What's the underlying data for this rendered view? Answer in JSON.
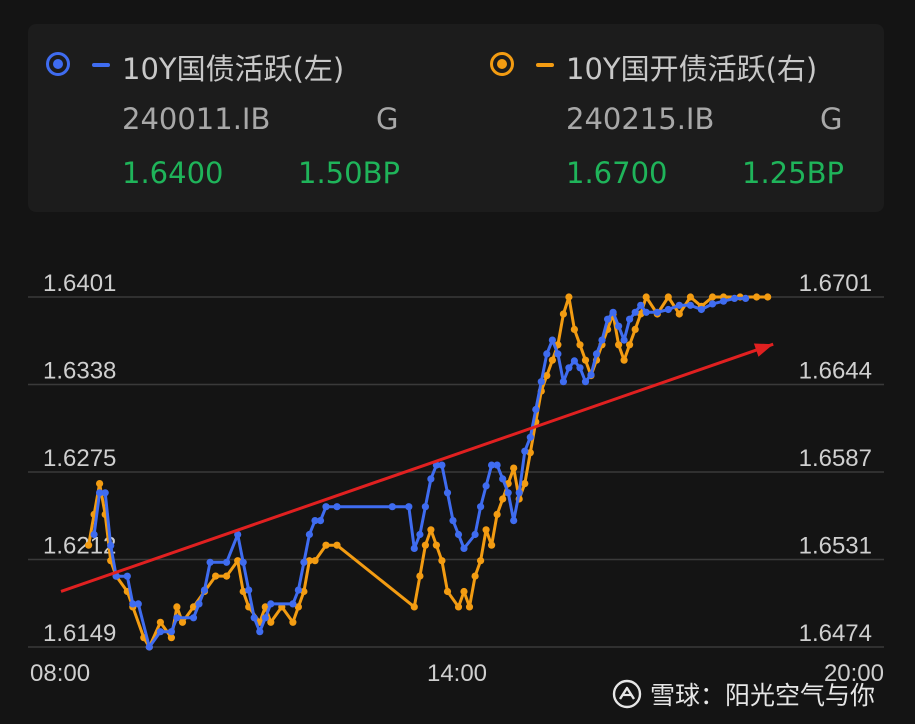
{
  "legend": {
    "left": {
      "name": "10Y国债活跃(左)",
      "code": "240011.IB",
      "flag": "G",
      "price": "1.6400",
      "change": "1.50BP",
      "color": "#3f6cf0"
    },
    "right": {
      "name": "10Y国开债活跃(右)",
      "code": "240215.IB",
      "flag": "G",
      "price": "1.6700",
      "change": "1.25BP",
      "color": "#f39c12"
    }
  },
  "watermark": {
    "text": "雪球：阳光空气与你",
    "icon": "snowball-logo-icon"
  },
  "colors": {
    "background": "#141414",
    "panel": "#1c1c1c",
    "up_green": "#1fb45a",
    "arrow_red": "#e02020",
    "grid": "#3a3a3a"
  },
  "chart_data": {
    "type": "line",
    "x_ticks": [
      "08:00",
      "14:00",
      "20:00"
    ],
    "x_range": [
      "08:00",
      "20:00"
    ],
    "left_axis": {
      "ticks": [
        "1.6401",
        "1.6338",
        "1.6275",
        "1.6212",
        "1.6149"
      ],
      "range": [
        1.6149,
        1.6401
      ]
    },
    "right_axis": {
      "ticks": [
        "1.6701",
        "1.6644",
        "1.6587",
        "1.6531",
        "1.6474"
      ],
      "range": [
        1.6474,
        1.6701
      ]
    },
    "grid": true,
    "annotation": {
      "type": "arrow",
      "from": {
        "t": "08:00",
        "left_value": 1.6189
      },
      "to": {
        "t": "18:45",
        "left_value": 1.6367
      }
    },
    "series": [
      {
        "name": "10Y国债活跃(左)",
        "axis": "left",
        "color": "#3f6cf0",
        "points": [
          [
            "08:30",
            1.623
          ],
          [
            "08:35",
            1.626
          ],
          [
            "08:40",
            1.626
          ],
          [
            "08:45",
            1.6222
          ],
          [
            "08:50",
            1.62
          ],
          [
            "09:00",
            1.62
          ],
          [
            "09:05",
            1.618
          ],
          [
            "09:10",
            1.618
          ],
          [
            "09:20",
            1.6149
          ],
          [
            "09:30",
            1.616
          ],
          [
            "09:40",
            1.616
          ],
          [
            "09:45",
            1.617
          ],
          [
            "10:00",
            1.617
          ],
          [
            "10:05",
            1.618
          ],
          [
            "10:10",
            1.619
          ],
          [
            "10:15",
            1.621
          ],
          [
            "10:30",
            1.621
          ],
          [
            "10:40",
            1.623
          ],
          [
            "10:45",
            1.621
          ],
          [
            "10:50",
            1.619
          ],
          [
            "10:55",
            1.617
          ],
          [
            "11:00",
            1.616
          ],
          [
            "11:05",
            1.617
          ],
          [
            "11:10",
            1.618
          ],
          [
            "11:30",
            1.618
          ],
          [
            "11:35",
            1.619
          ],
          [
            "11:40",
            1.621
          ],
          [
            "11:45",
            1.623
          ],
          [
            "11:50",
            1.624
          ],
          [
            "11:55",
            1.624
          ],
          [
            "12:00",
            1.625
          ],
          [
            "12:10",
            1.625
          ],
          [
            "13:00",
            1.625
          ],
          [
            "13:15",
            1.625
          ],
          [
            "13:20",
            1.622
          ],
          [
            "13:25",
            1.623
          ],
          [
            "13:30",
            1.625
          ],
          [
            "13:35",
            1.627
          ],
          [
            "13:40",
            1.628
          ],
          [
            "13:45",
            1.628
          ],
          [
            "13:50",
            1.626
          ],
          [
            "13:55",
            1.624
          ],
          [
            "14:00",
            1.623
          ],
          [
            "14:05",
            1.622
          ],
          [
            "14:15",
            1.623
          ],
          [
            "14:20",
            1.625
          ],
          [
            "14:25",
            1.6265
          ],
          [
            "14:30",
            1.628
          ],
          [
            "14:35",
            1.628
          ],
          [
            "14:40",
            1.627
          ],
          [
            "14:45",
            1.626
          ],
          [
            "14:50",
            1.624
          ],
          [
            "14:55",
            1.626
          ],
          [
            "15:00",
            1.629
          ],
          [
            "15:05",
            1.63
          ],
          [
            "15:10",
            1.632
          ],
          [
            "15:15",
            1.634
          ],
          [
            "15:20",
            1.636
          ],
          [
            "15:25",
            1.637
          ],
          [
            "15:30",
            1.636
          ],
          [
            "15:35",
            1.634
          ],
          [
            "15:40",
            1.635
          ],
          [
            "15:45",
            1.6355
          ],
          [
            "15:50",
            1.635
          ],
          [
            "15:55",
            1.634
          ],
          [
            "16:00",
            1.6345
          ],
          [
            "16:05",
            1.636
          ],
          [
            "16:10",
            1.637
          ],
          [
            "16:15",
            1.6385
          ],
          [
            "16:20",
            1.639
          ],
          [
            "16:25",
            1.638
          ],
          [
            "16:30",
            1.637
          ],
          [
            "16:35",
            1.6385
          ],
          [
            "16:40",
            1.639
          ],
          [
            "16:45",
            1.6395
          ],
          [
            "16:50",
            1.639
          ],
          [
            "17:00",
            1.639
          ],
          [
            "17:10",
            1.6392
          ],
          [
            "17:20",
            1.6395
          ],
          [
            "17:30",
            1.6395
          ],
          [
            "17:40",
            1.6392
          ],
          [
            "17:50",
            1.6396
          ],
          [
            "18:00",
            1.6398
          ],
          [
            "18:10",
            1.64
          ],
          [
            "18:20",
            1.64
          ]
        ]
      },
      {
        "name": "10Y国开债活跃(右)",
        "axis": "right",
        "color": "#f39c12",
        "points": [
          [
            "08:25",
            1.654
          ],
          [
            "08:30",
            1.656
          ],
          [
            "08:35",
            1.658
          ],
          [
            "08:40",
            1.656
          ],
          [
            "08:45",
            1.653
          ],
          [
            "08:50",
            1.652
          ],
          [
            "09:00",
            1.651
          ],
          [
            "09:05",
            1.65
          ],
          [
            "09:15",
            1.648
          ],
          [
            "09:20",
            1.6474
          ],
          [
            "09:30",
            1.649
          ],
          [
            "09:40",
            1.648
          ],
          [
            "09:45",
            1.65
          ],
          [
            "09:50",
            1.649
          ],
          [
            "10:00",
            1.65
          ],
          [
            "10:10",
            1.651
          ],
          [
            "10:20",
            1.652
          ],
          [
            "10:30",
            1.652
          ],
          [
            "10:40",
            1.653
          ],
          [
            "10:45",
            1.651
          ],
          [
            "10:50",
            1.65
          ],
          [
            "11:00",
            1.649
          ],
          [
            "11:05",
            1.65
          ],
          [
            "11:10",
            1.649
          ],
          [
            "11:20",
            1.65
          ],
          [
            "11:30",
            1.649
          ],
          [
            "11:35",
            1.65
          ],
          [
            "11:40",
            1.651
          ],
          [
            "11:45",
            1.653
          ],
          [
            "11:50",
            1.653
          ],
          [
            "12:00",
            1.654
          ],
          [
            "12:10",
            1.654
          ],
          [
            "13:20",
            1.65
          ],
          [
            "13:25",
            1.652
          ],
          [
            "13:30",
            1.654
          ],
          [
            "13:35",
            1.655
          ],
          [
            "13:40",
            1.654
          ],
          [
            "13:45",
            1.653
          ],
          [
            "13:50",
            1.651
          ],
          [
            "14:00",
            1.65
          ],
          [
            "14:05",
            1.651
          ],
          [
            "14:10",
            1.65
          ],
          [
            "14:15",
            1.652
          ],
          [
            "14:20",
            1.653
          ],
          [
            "14:25",
            1.655
          ],
          [
            "14:30",
            1.654
          ],
          [
            "14:35",
            1.656
          ],
          [
            "14:40",
            1.657
          ],
          [
            "14:45",
            1.658
          ],
          [
            "14:50",
            1.659
          ],
          [
            "14:55",
            1.657
          ],
          [
            "15:00",
            1.658
          ],
          [
            "15:05",
            1.66
          ],
          [
            "15:10",
            1.662
          ],
          [
            "15:15",
            1.664
          ],
          [
            "15:20",
            1.665
          ],
          [
            "15:25",
            1.666
          ],
          [
            "15:30",
            1.667
          ],
          [
            "15:35",
            1.669
          ],
          [
            "15:40",
            1.6701
          ],
          [
            "15:45",
            1.668
          ],
          [
            "15:50",
            1.667
          ],
          [
            "15:55",
            1.666
          ],
          [
            "16:00",
            1.665
          ],
          [
            "16:05",
            1.666
          ],
          [
            "16:10",
            1.667
          ],
          [
            "16:15",
            1.668
          ],
          [
            "16:20",
            1.669
          ],
          [
            "16:25",
            1.667
          ],
          [
            "16:30",
            1.666
          ],
          [
            "16:35",
            1.667
          ],
          [
            "16:40",
            1.668
          ],
          [
            "16:45",
            1.669
          ],
          [
            "16:50",
            1.6701
          ],
          [
            "17:00",
            1.669
          ],
          [
            "17:10",
            1.6701
          ],
          [
            "17:20",
            1.669
          ],
          [
            "17:30",
            1.6701
          ],
          [
            "17:40",
            1.6695
          ],
          [
            "17:50",
            1.6701
          ],
          [
            "18:00",
            1.6701
          ],
          [
            "18:15",
            1.6701
          ],
          [
            "18:30",
            1.6701
          ],
          [
            "18:40",
            1.6701
          ]
        ]
      }
    ]
  }
}
